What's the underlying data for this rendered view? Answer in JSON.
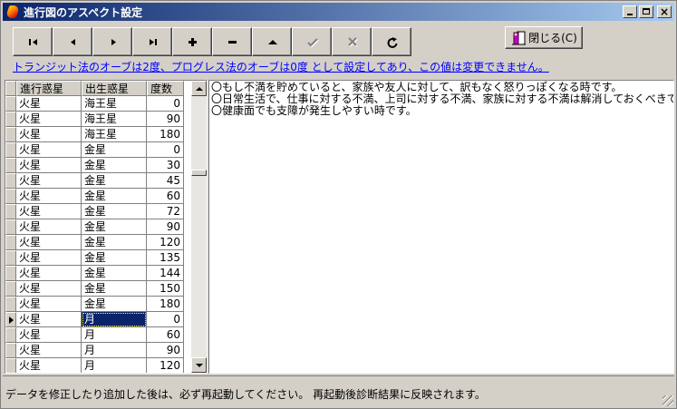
{
  "window": {
    "title": "進行図のアスペクト設定"
  },
  "toolbar": {
    "buttons": [
      {
        "name": "first-record-button",
        "icon": "first-icon",
        "enabled": true
      },
      {
        "name": "prior-record-button",
        "icon": "prior-icon",
        "enabled": true
      },
      {
        "name": "next-record-button",
        "icon": "next-icon",
        "enabled": true
      },
      {
        "name": "last-record-button",
        "icon": "last-icon",
        "enabled": true
      },
      {
        "name": "insert-record-button",
        "icon": "plus-icon",
        "enabled": true
      },
      {
        "name": "delete-record-button",
        "icon": "minus-icon",
        "enabled": true
      },
      {
        "name": "edit-record-button",
        "icon": "up-triangle-icon",
        "enabled": true
      },
      {
        "name": "post-record-button",
        "icon": "check-icon",
        "enabled": false
      },
      {
        "name": "cancel-record-button",
        "icon": "x-icon",
        "enabled": false
      },
      {
        "name": "refresh-button",
        "icon": "refresh-icon",
        "enabled": true
      }
    ],
    "close_label": "閉じる(C)"
  },
  "info_link": "トランジット法のオーブは2度、プログレス法のオーブは0度 として設定してあり、この値は変更できません。",
  "grid": {
    "headers": [
      "進行惑星",
      "出生惑星",
      "度数"
    ],
    "rows": [
      [
        "火星",
        "海王星",
        "0"
      ],
      [
        "火星",
        "海王星",
        "90"
      ],
      [
        "火星",
        "海王星",
        "180"
      ],
      [
        "火星",
        "金星",
        "0"
      ],
      [
        "火星",
        "金星",
        "30"
      ],
      [
        "火星",
        "金星",
        "45"
      ],
      [
        "火星",
        "金星",
        "60"
      ],
      [
        "火星",
        "金星",
        "72"
      ],
      [
        "火星",
        "金星",
        "90"
      ],
      [
        "火星",
        "金星",
        "120"
      ],
      [
        "火星",
        "金星",
        "135"
      ],
      [
        "火星",
        "金星",
        "144"
      ],
      [
        "火星",
        "金星",
        "150"
      ],
      [
        "火星",
        "金星",
        "180"
      ],
      [
        "火星",
        "月",
        "0"
      ],
      [
        "火星",
        "月",
        "60"
      ],
      [
        "火星",
        "月",
        "90"
      ],
      [
        "火星",
        "月",
        "120"
      ]
    ],
    "current_row": 14
  },
  "memo": {
    "lines": [
      "〇もし不満を貯めていると、家族や友人に対して、訳もなく怒りっぽくなる時です。",
      "〇日常生活で、仕事に対する不満、上司に対する不満、家族に対する不満は解消しておくべきです。",
      "〇健康面でも支障が発生しやすい時です。"
    ]
  },
  "status": {
    "text": "データを修正したり追加した後は、必ず再起動してください。 再起動後診断結果に反映されます。"
  },
  "colors": {
    "face": "#d4d0c8",
    "title_start": "#0a246a",
    "title_end": "#a6caf0",
    "link": "#0000ff",
    "selection": "#0a246a"
  }
}
